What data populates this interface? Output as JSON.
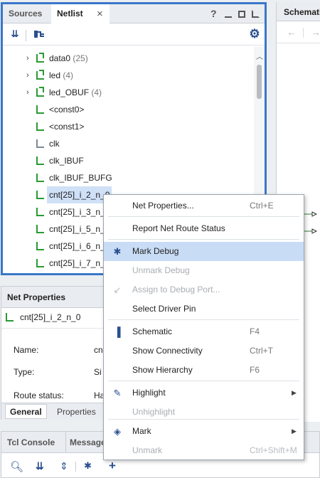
{
  "netlist_panel": {
    "tabs": [
      "Sources",
      "Netlist"
    ],
    "close_glyph": "×",
    "help_glyph": "?",
    "tree": [
      {
        "expander": "›",
        "label": "data0",
        "count": "(25)",
        "icon": "bus-net-icon"
      },
      {
        "expander": "›",
        "label": "led",
        "count": "(4)",
        "icon": "bus-net-icon"
      },
      {
        "expander": "›",
        "label": "led_OBUF",
        "count": "(4)",
        "icon": "bus-net-icon"
      },
      {
        "expander": "",
        "label": "<const0>",
        "count": "",
        "icon": "net-icon"
      },
      {
        "expander": "",
        "label": "<const1>",
        "count": "",
        "icon": "net-icon"
      },
      {
        "expander": "",
        "label": "clk",
        "count": "",
        "icon": "clock-net-icon"
      },
      {
        "expander": "",
        "label": "clk_IBUF",
        "count": "",
        "icon": "net-icon"
      },
      {
        "expander": "",
        "label": "clk_IBUF_BUFG",
        "count": "",
        "icon": "net-icon"
      },
      {
        "expander": "",
        "label": "cnt[25]_i_2_n_0",
        "count": "",
        "icon": "net-icon",
        "selected": true
      },
      {
        "expander": "",
        "label": "cnt[25]_i_3_n_",
        "count": "",
        "icon": "net-icon"
      },
      {
        "expander": "",
        "label": "cnt[25]_i_5_n_",
        "count": "",
        "icon": "net-icon"
      },
      {
        "expander": "",
        "label": "cnt[25]_i_6_n_",
        "count": "",
        "icon": "net-icon"
      },
      {
        "expander": "",
        "label": "cnt[25]_i_7_n_",
        "count": "",
        "icon": "net-icon"
      }
    ]
  },
  "schematic_panel": {
    "tab": "Schemati"
  },
  "net_properties": {
    "title": "Net Properties",
    "selected_net": "cnt[25]_i_2_n_0",
    "rows": [
      {
        "label": "Name:",
        "value": "cn"
      },
      {
        "label": "Type:",
        "value": "Si"
      },
      {
        "label": "Route status:",
        "value": "Ha"
      }
    ],
    "tabs": [
      "General",
      "Properties"
    ]
  },
  "tcl_console": {
    "tabs": [
      "Tcl Console",
      "Message"
    ]
  },
  "context_menu": {
    "items": [
      {
        "label": "Net Properties...",
        "shortcut": "Ctrl+E",
        "icon": "",
        "disabled": false
      },
      {
        "label": "Report Net Route Status",
        "shortcut": "",
        "icon": "",
        "disabled": false
      },
      {
        "label": "Mark Debug",
        "shortcut": "",
        "icon": "bug-icon",
        "disabled": false,
        "highlighted": true
      },
      {
        "label": "Unmark Debug",
        "shortcut": "",
        "icon": "",
        "disabled": true
      },
      {
        "label": "Assign to Debug Port...",
        "shortcut": "",
        "icon": "assign-debug-icon",
        "disabled": true
      },
      {
        "label": "Select Driver Pin",
        "shortcut": "",
        "icon": "",
        "disabled": false
      },
      {
        "label": "Schematic",
        "shortcut": "F4",
        "icon": "schematic-icon",
        "disabled": false
      },
      {
        "label": "Show Connectivity",
        "shortcut": "Ctrl+T",
        "icon": "",
        "disabled": false
      },
      {
        "label": "Show Hierarchy",
        "shortcut": "F6",
        "icon": "",
        "disabled": false
      },
      {
        "label": "Highlight",
        "shortcut": "",
        "icon": "highlight-icon",
        "disabled": false,
        "submenu": true
      },
      {
        "label": "Unhighlight",
        "shortcut": "",
        "icon": "",
        "disabled": true
      },
      {
        "label": "Mark",
        "shortcut": "",
        "icon": "mark-icon",
        "disabled": false,
        "submenu": true
      },
      {
        "label": "Unmark",
        "shortcut": "Ctrl+Shift+M",
        "icon": "",
        "disabled": true
      }
    ]
  },
  "colors": {
    "accent_border": "#3a77c9",
    "menu_highlight": "#c9dcf6",
    "net_icon": "#2a9a35"
  }
}
